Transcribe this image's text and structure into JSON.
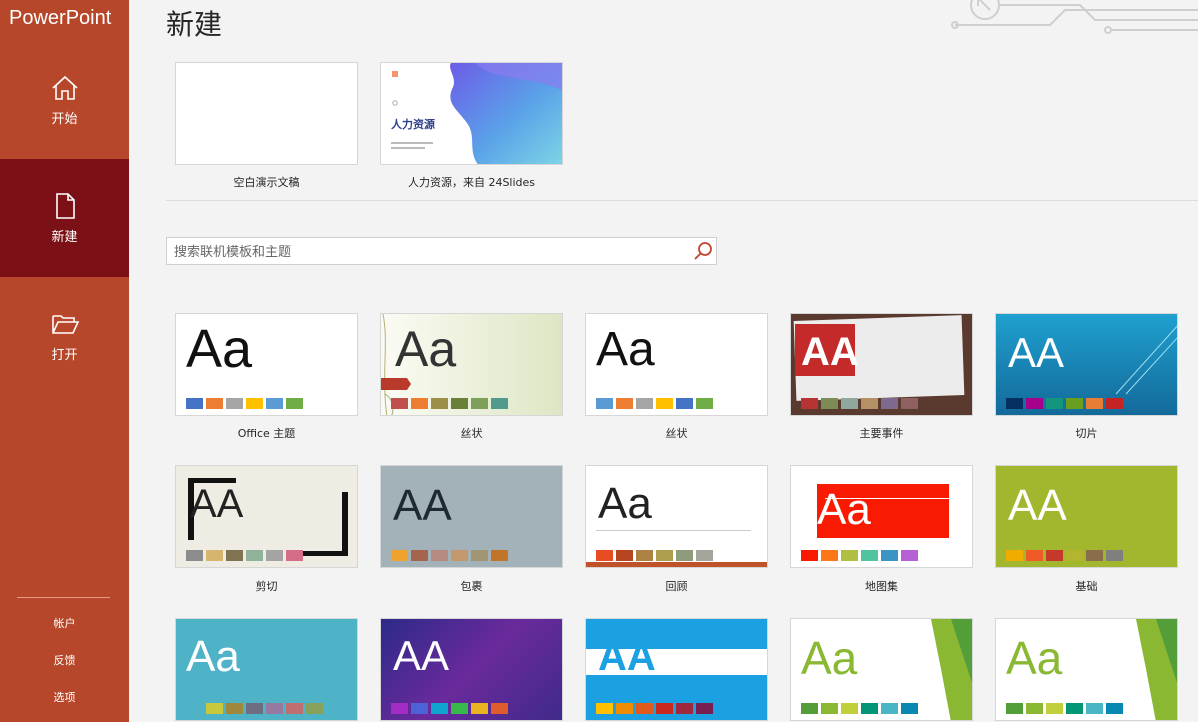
{
  "app": {
    "title": "PowerPoint"
  },
  "sidebar": {
    "nav": [
      {
        "label": "开始",
        "icon": "home-icon"
      },
      {
        "label": "新建",
        "icon": "new-file-icon",
        "active": true
      },
      {
        "label": "打开",
        "icon": "folder-open-icon"
      }
    ],
    "bottom": [
      "帐户",
      "反馈",
      "选项"
    ]
  },
  "page": {
    "title": "新建"
  },
  "featured": [
    {
      "caption": "空白演示文稿"
    },
    {
      "caption": "人力资源，来自 24Slides",
      "preview_title": "人力资源"
    }
  ],
  "search": {
    "placeholder": "搜索联机模板和主题",
    "icon": "search-icon"
  },
  "themes": [
    {
      "caption": "Office 主题",
      "preview": "Aa",
      "colors": [
        "#4472c4",
        "#ed7d31",
        "#a5a5a5",
        "#ffc000",
        "#5b9bd5",
        "#70ad47"
      ]
    },
    {
      "caption": "丝状",
      "preview": "Aa",
      "colors": [
        "#c0504d",
        "#ed7d31",
        "#9c8f4a",
        "#6a7f38",
        "#7fa05a",
        "#4f9b8c"
      ]
    },
    {
      "caption": "丝状",
      "preview": "Aa",
      "colors": [
        "#5b9bd5",
        "#ed7d31",
        "#a5a5a5",
        "#ffc000",
        "#4472c4",
        "#70ad47"
      ]
    },
    {
      "caption": "主要事件",
      "preview": "AA",
      "colors": [
        "#b83434",
        "#7d8c54",
        "#8fa89c",
        "#b49164",
        "#7f6a8f",
        "#8e6060"
      ]
    },
    {
      "caption": "切片",
      "preview": "AA",
      "colors": [
        "#052f61",
        "#a5008c",
        "#14967c",
        "#6a9e1f",
        "#e87d37",
        "#c62324"
      ]
    },
    {
      "caption": "剪切",
      "preview": "AA",
      "colors": [
        "#8c8c8c",
        "#d6b56e",
        "#7f7352",
        "#8fb29a",
        "#a4a4a4",
        "#d46d88"
      ]
    },
    {
      "caption": "包裹",
      "preview": "AA",
      "colors": [
        "#f0a22e",
        "#a5644e",
        "#b58b80",
        "#c3986d",
        "#a19574",
        "#c17529"
      ]
    },
    {
      "caption": "回顾",
      "preview": "Aa",
      "colors": [
        "#e84c22",
        "#b74620",
        "#ac8142",
        "#ad9f4f",
        "#8f9c7c",
        "#a3a69a"
      ]
    },
    {
      "caption": "地图集",
      "preview": "Aa",
      "colors": [
        "#f81b02",
        "#fc7715",
        "#afbf41",
        "#50c49f",
        "#3b95c4",
        "#b560d4"
      ]
    },
    {
      "caption": "基础",
      "preview": "AA",
      "colors": [
        "#f0ad00",
        "#f05a28",
        "#c6382c",
        "#b3b52e",
        "#8a6e4b",
        "#7f7f7f"
      ]
    },
    {
      "caption": "",
      "preview": "Aa",
      "colors": [
        "#c8c83c",
        "#a0873c",
        "#6e6e82",
        "#9678a0",
        "#be6e6e",
        "#87a05a"
      ]
    },
    {
      "caption": "",
      "preview": "AA",
      "colors": [
        "#a32cc4",
        "#4d62d6",
        "#0fa4cf",
        "#39b84b",
        "#e8b422",
        "#e05c2d"
      ]
    },
    {
      "caption": "",
      "preview": "AA",
      "colors": [
        "#ffc000",
        "#f08c00",
        "#e05a1e",
        "#c8281e",
        "#a0283c",
        "#781e50"
      ]
    },
    {
      "caption": "",
      "preview": "Aa",
      "colors": [
        "#549e39",
        "#8ab833",
        "#c0cf3a",
        "#029676",
        "#4ab5c4",
        "#0989b1"
      ]
    },
    {
      "caption": "",
      "preview": "Aa",
      "colors": [
        "#549e39",
        "#8ab833",
        "#c0cf3a",
        "#029676",
        "#4ab5c4",
        "#0989b1"
      ]
    }
  ]
}
